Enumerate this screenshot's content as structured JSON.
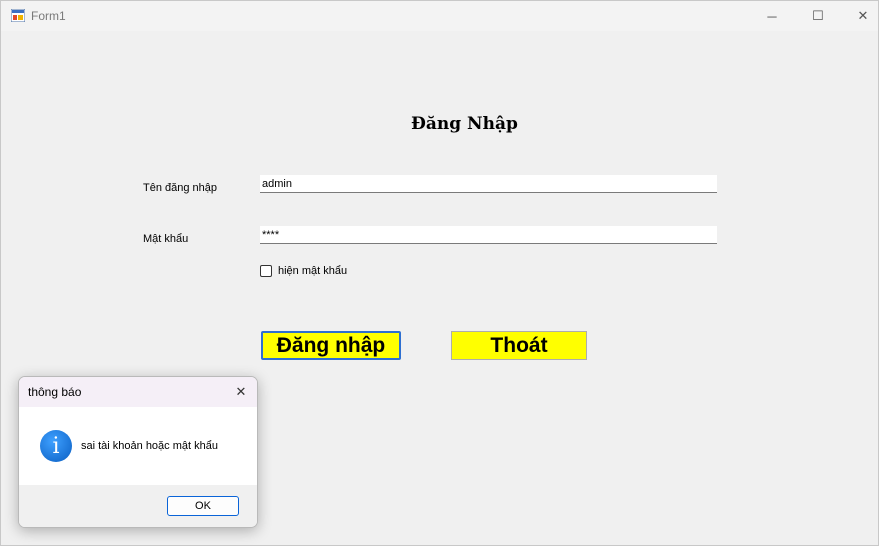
{
  "window": {
    "title": "Form1",
    "minimize_glyph": "─",
    "maximize_glyph": "☐",
    "close_glyph": "✕"
  },
  "form": {
    "heading": "Đăng Nhập",
    "username_label": "Tên đăng nhập",
    "username_value": "admin",
    "password_label": "Mật khẩu",
    "password_value": "****",
    "show_password_label": "hiện mật khẩu",
    "show_password_checked": false,
    "login_button": "Đăng nhập",
    "exit_button": "Thoát",
    "button_color": "#ffff00"
  },
  "dialog": {
    "title": "thông báo",
    "close_glyph": "✕",
    "icon": "info-icon",
    "icon_glyph": "i",
    "message": "sai tài khoản hoặc mật khẩu",
    "ok_button": "OK"
  }
}
